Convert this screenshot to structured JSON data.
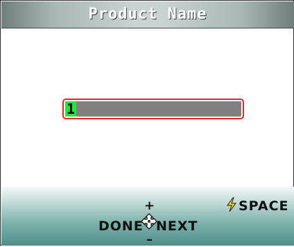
{
  "title": "Product Name",
  "entry": {
    "value": "1"
  },
  "footer": {
    "plus": "+",
    "minus": "–",
    "done_label": "DONE",
    "next_label": "NEXT",
    "space_label": "SPACE"
  },
  "icons": {
    "dpad": "dpad-icon",
    "space": "lightning-bolt-icon"
  },
  "colors": {
    "cursor": "#27e43a",
    "field_border": "#e0252b",
    "field_fill": "#808080",
    "bolt": "#f1d61b"
  }
}
